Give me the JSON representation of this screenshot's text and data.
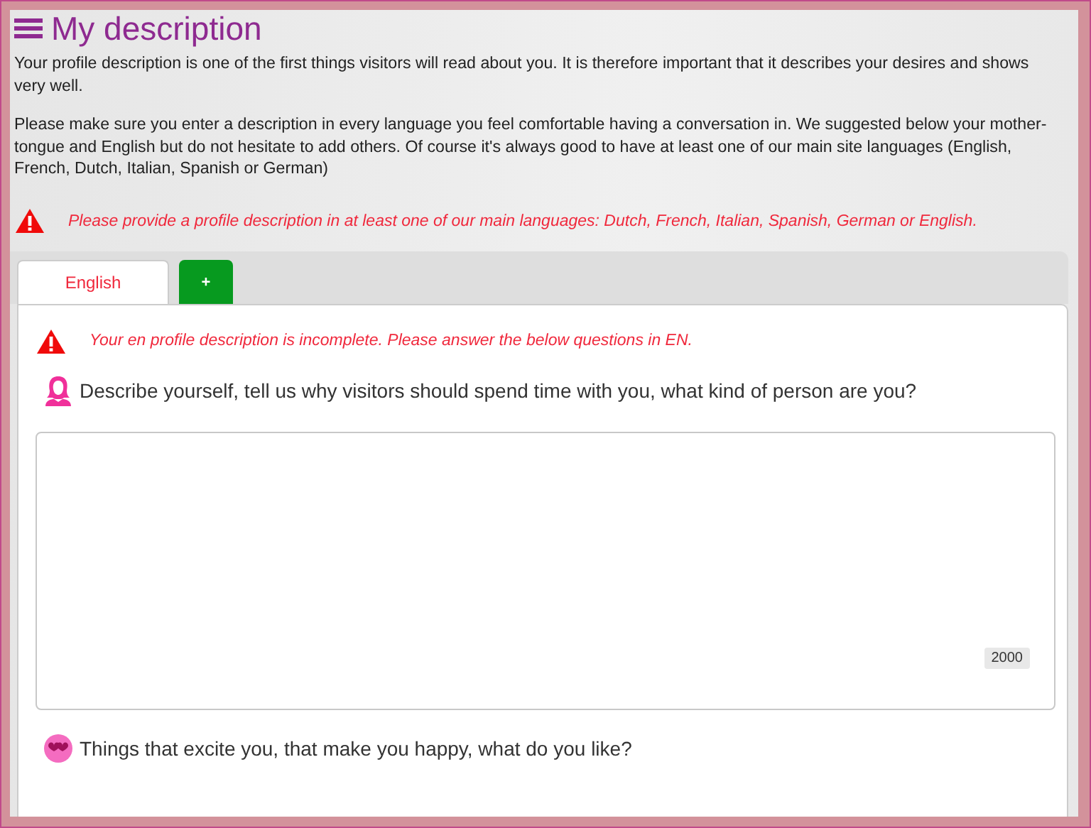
{
  "header": {
    "title": "My description"
  },
  "intro": [
    "Your profile description is one of the first things visitors will read about you. It is therefore important that it describes your desires and shows very well.",
    "Please make sure you enter a description in every language you feel comfortable having a conversation in. We suggested below your mother-tongue and English but do not hesitate to add others. Of course it's always good to have at least one of our main site languages (English, French, Dutch, Italian, Spanish or German)"
  ],
  "alert": "Please provide a profile description in at least one of our main languages: Dutch, French, Italian, Spanish, German or English.",
  "tabs": [
    {
      "label": "English",
      "selected": true,
      "kind": "language"
    },
    {
      "label": "+",
      "selected": false,
      "kind": "add"
    }
  ],
  "panel": {
    "alert": "Your en profile description is incomplete. Please answer the below questions in EN.",
    "questions": [
      {
        "kind": "person",
        "label": "Describe yourself, tell us why visitors should spend time with you, what kind of person are you?",
        "counter": "2000"
      },
      {
        "kind": "hearts",
        "label": "Things that excite you, that make you happy, what do you like?"
      }
    ]
  }
}
